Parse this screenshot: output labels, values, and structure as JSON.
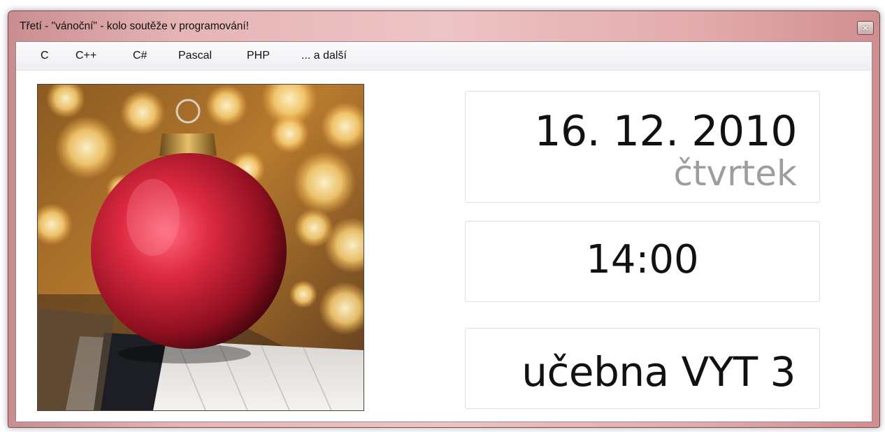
{
  "window": {
    "title": "Třetí - \"vánoční\" - kolo soutěže v programování!",
    "close_label": "×"
  },
  "menu": {
    "items": [
      "C",
      "C++",
      "C#",
      "Pascal",
      "PHP",
      "... a další"
    ]
  },
  "event": {
    "date": "16. 12. 2010",
    "day": "čtvrtek",
    "time": "14:00",
    "room": "učebna VYT 3"
  },
  "colors": {
    "titlebar_accent": "#e8b9ba",
    "day_text": "#9d9d9d",
    "ornament_red": "#c81e32"
  }
}
